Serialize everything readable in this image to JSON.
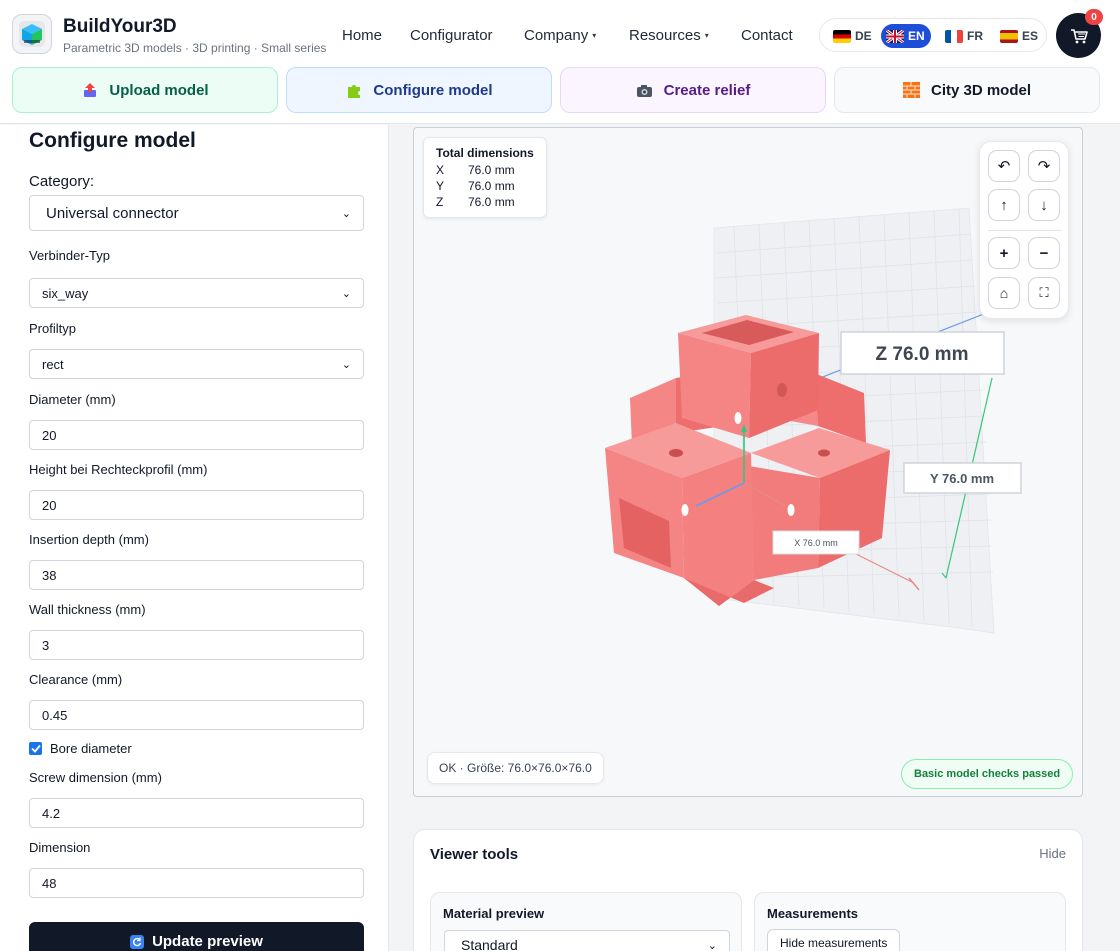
{
  "brand": {
    "title": "BuildYour3D",
    "subtitle": "Parametric 3D models · 3D printing · Small series"
  },
  "nav": [
    {
      "label": "Home",
      "dropdown": false
    },
    {
      "label": "Configurator",
      "dropdown": false
    },
    {
      "label": "Company",
      "dropdown": true
    },
    {
      "label": "Resources",
      "dropdown": true
    },
    {
      "label": "Contact",
      "dropdown": false
    }
  ],
  "nav_caret": "▾",
  "languages": [
    {
      "code": "DE",
      "active": false
    },
    {
      "code": "EN",
      "active": true
    },
    {
      "code": "FR",
      "active": false
    },
    {
      "code": "ES",
      "active": false
    }
  ],
  "cart": {
    "count": "0",
    "icon": "cart-icon"
  },
  "modes": [
    {
      "label": "Upload model",
      "icon": "upload-icon",
      "bg": "#ecfdf5",
      "border": "#a7f3d0",
      "color": "#065f46"
    },
    {
      "label": "Configure model",
      "icon": "puzzle-icon",
      "bg": "#eff6ff",
      "border": "#bfdbfe",
      "color": "#1e3a8a"
    },
    {
      "label": "Create relief",
      "icon": "camera-icon",
      "bg": "#faf5ff",
      "border": "#e9d5ff",
      "color": "#581c87"
    },
    {
      "label": "City 3D model",
      "icon": "bricks-icon",
      "bg": "#f9fafb",
      "border": "#e5e7eb",
      "color": "#111827"
    }
  ],
  "config": {
    "title": "Configure model",
    "category_label": "Category:",
    "category_value": "Universal connector",
    "fields": [
      {
        "label": "Verbinder-Typ",
        "value": "six_way",
        "type": "select"
      },
      {
        "label": "Profiltyp",
        "value": "rect",
        "type": "select"
      },
      {
        "label": "Diameter (mm)",
        "value": "20",
        "type": "input"
      },
      {
        "label": "Height bei Rechteckprofil (mm)",
        "value": "20",
        "type": "input"
      },
      {
        "label": "Insertion depth (mm)",
        "value": "38",
        "type": "input"
      },
      {
        "label": "Wall thickness (mm)",
        "value": "3",
        "type": "input"
      },
      {
        "label": "Clearance (mm)",
        "value": "0.45",
        "type": "input"
      }
    ],
    "checkbox": {
      "label": "Bore diameter",
      "checked": true
    },
    "fields2": [
      {
        "label": "Screw dimension (mm)",
        "value": "4.2"
      },
      {
        "label": "Dimension",
        "value": "48"
      }
    ],
    "update_label": "Update preview"
  },
  "viewer": {
    "dims_title": "Total dimensions",
    "dims": [
      {
        "axis": "X",
        "value": "76.0 mm"
      },
      {
        "axis": "Y",
        "value": "76.0 mm"
      },
      {
        "axis": "Z",
        "value": "76.0 mm"
      }
    ],
    "labels": {
      "z": "Z 76.0 mm",
      "y": "Y 76.0 mm",
      "x": "X 76.0 mm"
    },
    "status": "OK · Größe: 76.0×76.0×76.0",
    "checks": "Basic model checks passed",
    "model_color": "#f47a7a",
    "controls": [
      {
        "name": "rotate-left-button",
        "glyph": "↶"
      },
      {
        "name": "rotate-right-button",
        "glyph": "↷"
      },
      {
        "name": "pan-up-button",
        "glyph": "↑"
      },
      {
        "name": "pan-down-button",
        "glyph": "↓"
      },
      {
        "name": "zoom-in-button",
        "glyph": "+"
      },
      {
        "name": "zoom-out-button",
        "glyph": "−"
      },
      {
        "name": "reset-view-button",
        "glyph": "⌂"
      },
      {
        "name": "fullscreen-button",
        "glyph": "⛶"
      }
    ]
  },
  "tools": {
    "title": "Viewer tools",
    "hide_label": "Hide",
    "material_title": "Material preview",
    "material_value": "Standard",
    "measure_title": "Measurements",
    "measure_button": "Hide measurements"
  }
}
